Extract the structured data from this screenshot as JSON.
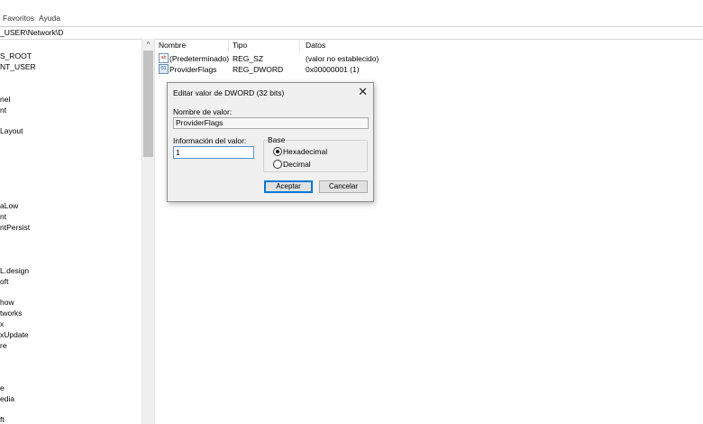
{
  "menu": [
    "Favoritos",
    "Ayuda"
  ],
  "address": "_USER\\Network\\D",
  "tree": [
    "S_ROOT",
    "NT_USER",
    "nel",
    "nt",
    "Layout",
    "",
    "aLow",
    "nt",
    "ntPersist",
    "L.design",
    "oft",
    "how",
    "tworks",
    "x",
    "xUpdate",
    "re",
    "e",
    "edia",
    "ft"
  ],
  "list": {
    "columns": [
      "Nombre",
      "Tipo",
      "Datos"
    ],
    "rows": [
      {
        "icon": "string-value-icon",
        "name": "(Predeterminado)",
        "type": "REG_SZ",
        "data": "(valor no establecido)"
      },
      {
        "icon": "dword-value-icon",
        "name": "ProviderFlags",
        "type": "REG_DWORD",
        "data": "0x00000001 (1)"
      }
    ]
  },
  "dialog": {
    "title": "Editar valor de DWORD (32 bits)",
    "name_label": "Nombre de valor:",
    "name_value": "ProviderFlags",
    "value_label": "Información del valor:",
    "value": "1",
    "base_label": "Base",
    "base_options": [
      "Hexadecimal",
      "Decimal"
    ],
    "base_selected": "Hexadecimal",
    "ok_label": "Aceptar",
    "cancel_label": "Cancelar",
    "close_glyph": "✕"
  },
  "colors": {
    "focus": "#0078d7",
    "dialog_bg": "#f0f0f0"
  }
}
